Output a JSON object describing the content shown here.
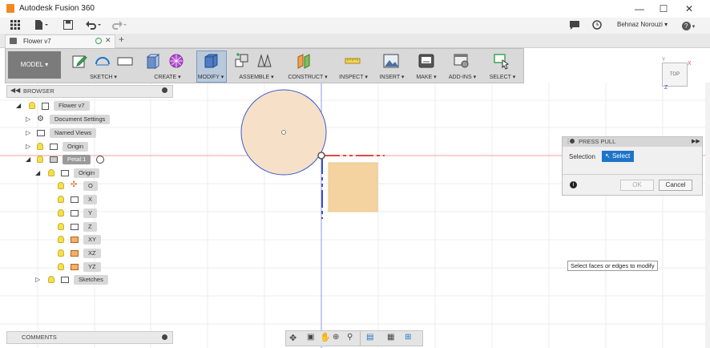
{
  "window": {
    "title": "Autodesk Fusion 360",
    "controls": [
      "minimize-icon",
      "maximize-icon",
      "close-icon"
    ]
  },
  "quick_access": {
    "user_name": "Behnaz Norouzi ▾",
    "help": "?",
    "icons": [
      "grid-icon",
      "file-icon",
      "save-icon",
      "undo-icon",
      "redo-icon",
      "chat-icon",
      "clock-icon",
      "help-icon"
    ]
  },
  "tabs": [
    {
      "label": "Flower v7"
    }
  ],
  "ribbon": {
    "workspace": "MODEL ▾",
    "groups": [
      {
        "label": "SKETCH ▾"
      },
      {
        "label": "CREATE ▾"
      },
      {
        "label": "MODIFY ▾"
      },
      {
        "label": "ASSEMBLE ▾"
      },
      {
        "label": "CONSTRUCT ▾"
      },
      {
        "label": "INSPECT ▾"
      },
      {
        "label": "INSERT ▾"
      },
      {
        "label": "MAKE ▾"
      },
      {
        "label": "ADD-INS ▾"
      },
      {
        "label": "SELECT ▾"
      }
    ]
  },
  "browser": {
    "title": "BROWSER",
    "items": [
      {
        "label": "Flower v7"
      },
      {
        "label": "Document Settings"
      },
      {
        "label": "Named Views"
      },
      {
        "label": "Origin"
      },
      {
        "label": "Petal:1"
      },
      {
        "label": "Origin"
      },
      {
        "label": "O"
      },
      {
        "label": "X"
      },
      {
        "label": "Y"
      },
      {
        "label": "Z"
      },
      {
        "label": "XY"
      },
      {
        "label": "XZ"
      },
      {
        "label": "YZ"
      },
      {
        "label": "Sketches"
      }
    ]
  },
  "viewcube": {
    "label": "TOP",
    "axis_x": "X",
    "axis_y": "Y",
    "axis_z": "Z"
  },
  "press_pull": {
    "title": "PRESS PULL",
    "selection_label": "Selection",
    "select_button": "Select",
    "ok": "OK",
    "cancel": "Cancel"
  },
  "tooltip": "Select faces or edges to modify",
  "comments": {
    "title": "COMMENTS"
  },
  "colors": {
    "accent_blue": "#1e74c9",
    "circle_fill": "#f6e1c8",
    "square_fill": "#f4d3a0",
    "axis_red": "#e04848",
    "axis_blue": "#3b4bd1"
  }
}
